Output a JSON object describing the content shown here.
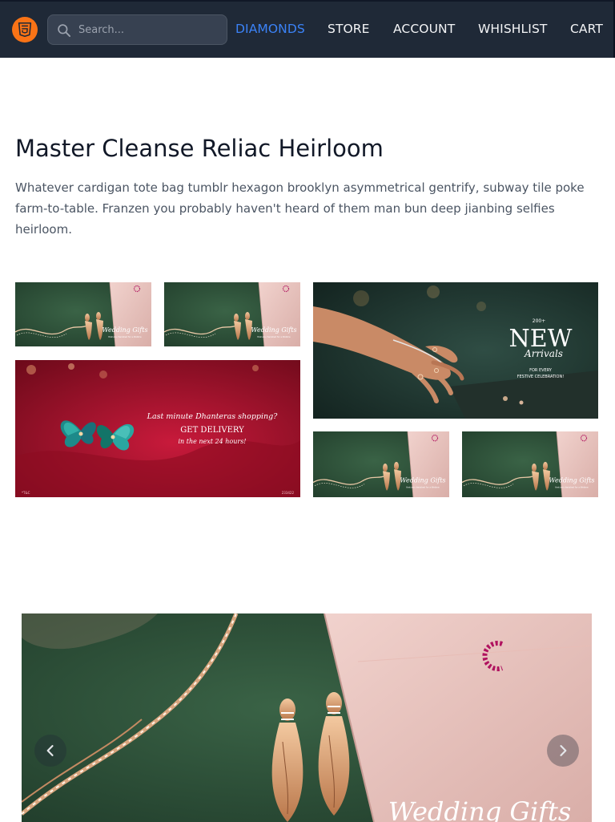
{
  "nav": {
    "search_placeholder": "Search...",
    "links": [
      "DIAMONDS",
      "STORE",
      "ACCOUNT",
      "WHISHLIST",
      "CART"
    ],
    "active_link": "DIAMONDS"
  },
  "hero": {
    "title": "Master Cleanse Reliac Heirloom",
    "description": "Whatever cardigan tote bag tumblr hexagon brooklyn asymmetrical gentrify, subway tile poke farm-to-table. Franzen you probably haven't heard of them man bun deep jianbing selfies heirloom."
  },
  "gallery": {
    "wedding_banner_text": "Wedding Gifts",
    "wedding_banner_subtext": "that are cherished for a lifetime",
    "dhanteras_line1": "Last minute Dhanteras shopping?",
    "dhanteras_line2": "GET DELIVERY",
    "dhanteras_line3": "in the next 24 hours!",
    "dhanteras_footer_left": "*T&C",
    "dhanteras_footer_right": "233422",
    "arrivals_count": "200+",
    "arrivals_big": "NEW",
    "arrivals_script": "Arrivals",
    "arrivals_sub1": "FOR EVERY",
    "arrivals_sub2": "FESTIVE CELEBRATION!"
  },
  "carousel": {
    "banner_text": "Wedding Gifts"
  },
  "colors": {
    "nav_bg": "#1f2937",
    "accent": "#3b82f6",
    "logo": "#f97316",
    "velvet_green": "#2b4f37",
    "box_pink": "#e8c2bd",
    "crimson": "#a8102a"
  },
  "icons": {
    "logo": "html5-icon",
    "search": "search-icon",
    "prev": "chevron-left-icon",
    "next": "chevron-right-icon"
  }
}
